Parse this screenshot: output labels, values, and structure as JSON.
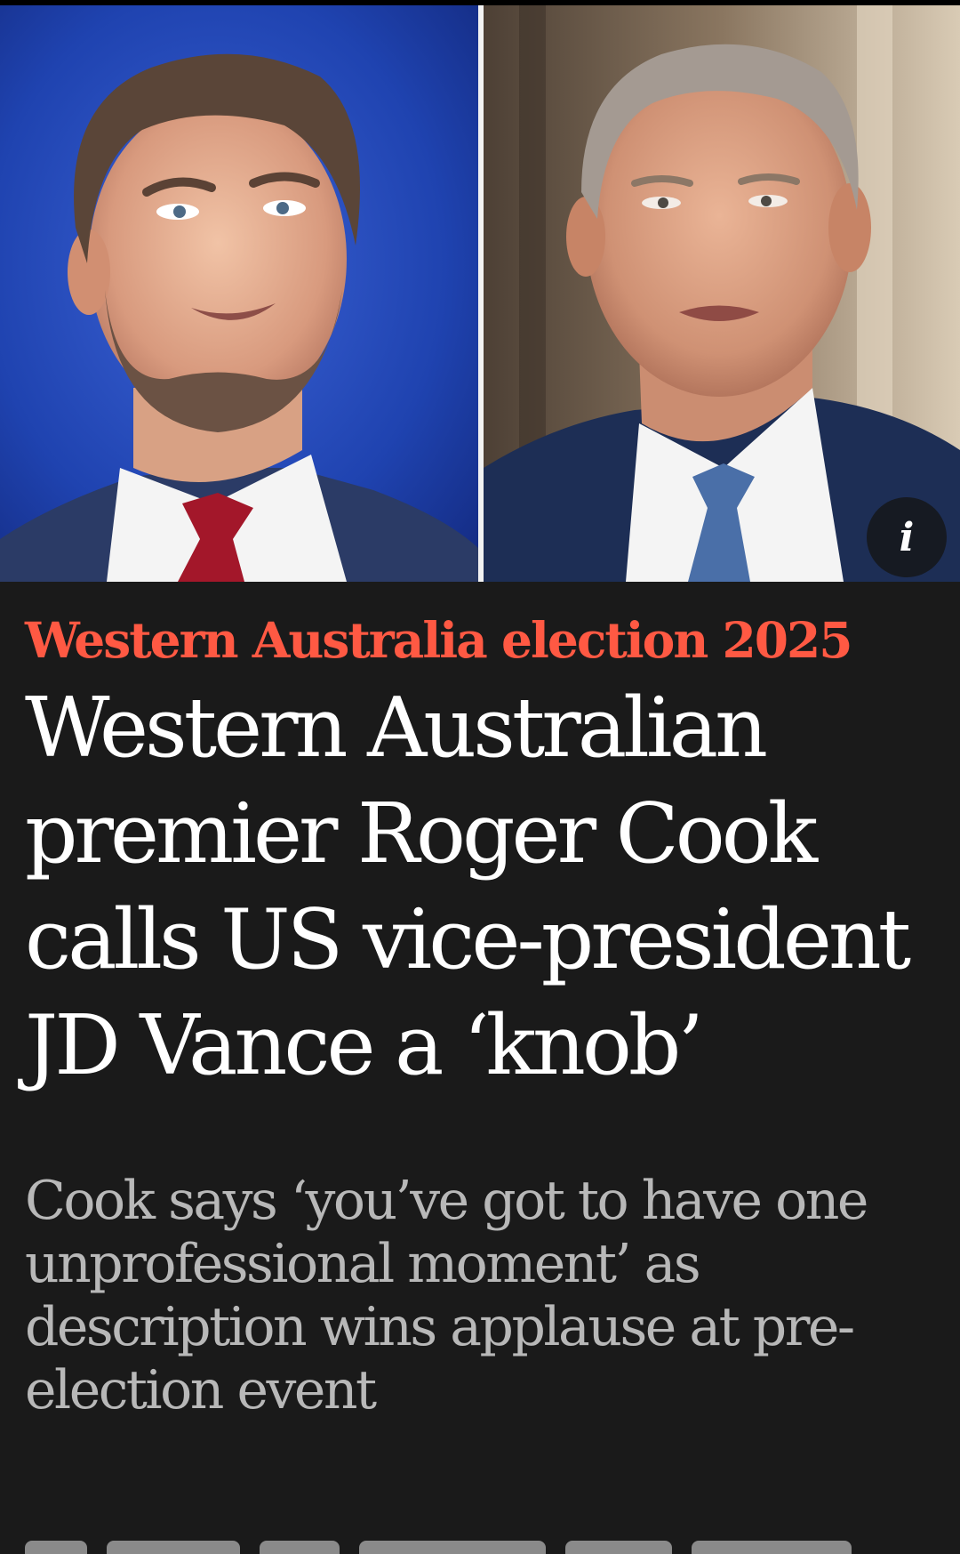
{
  "hero": {
    "left_photo_subject": "JD Vance portrait",
    "right_photo_subject": "Roger Cook portrait",
    "info_button_label": "i",
    "info_icon": "info-icon"
  },
  "article": {
    "kicker": "Western Australia election 2025",
    "headline": "Western Australian premier Roger Cook calls US vice-president JD Vance a ‘knob’",
    "standfirst": "Cook says ‘you’ve got to have one unprofessional moment’ as description wins applause at pre-election event"
  },
  "colors": {
    "background": "#1a1a1a",
    "kicker": "#ff5943",
    "headline": "#ffffff",
    "standfirst": "#b8b8b8",
    "left_backdrop": "#1f3fa8",
    "right_backdrop": "#8a7660"
  }
}
